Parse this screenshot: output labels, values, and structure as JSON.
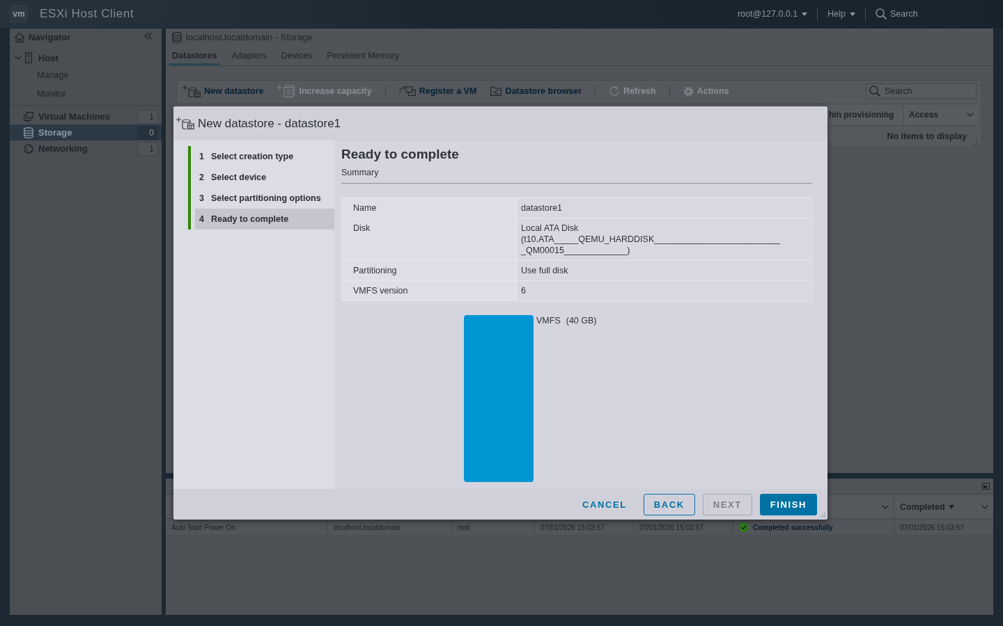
{
  "top_bar": {
    "logo": "vm",
    "title": "ESXi Host Client",
    "user_menu": "root@127.0.0.1",
    "help_menu": "Help",
    "search": {
      "placeholder": "Search"
    }
  },
  "navigator": {
    "title": "Navigator",
    "items": [
      {
        "label": "Host",
        "expanded": true,
        "selected": false,
        "children": [
          {
            "label": "Manage",
            "selected": false
          },
          {
            "label": "Monitor",
            "selected": false
          }
        ]
      },
      {
        "label": "Virtual Machines",
        "count": "1",
        "selected": false
      },
      {
        "label": "Storage",
        "count": "0",
        "selected": true
      },
      {
        "label": "Networking",
        "count": "1",
        "selected": false
      }
    ]
  },
  "storage_panel": {
    "title": "localhost.localdomain - Storage",
    "tabs": [
      {
        "label": "Datastores",
        "selected": true
      },
      {
        "label": "Adapters",
        "selected": false
      },
      {
        "label": "Devices",
        "selected": false
      },
      {
        "label": "Persistent Memory",
        "selected": false
      }
    ],
    "toolbar": [
      {
        "items": [
          {
            "label": "New datastore",
            "disabled": false
          },
          {
            "label": "Increase capacity",
            "disabled": true
          }
        ]
      },
      {
        "items": [
          {
            "label": "Register a VM",
            "disabled": false
          },
          {
            "label": "Datastore browser",
            "disabled": false
          }
        ]
      },
      {
        "items": [
          {
            "label": "Refresh",
            "disabled": true
          }
        ]
      },
      {
        "items": [
          {
            "label": "Actions",
            "disabled": true
          }
        ]
      }
    ],
    "search": {
      "placeholder": "Search"
    },
    "table": {
      "columns": [
        {
          "label": "hin provisioning",
          "menu": false
        },
        {
          "label": "Access",
          "menu": true
        }
      ],
      "empty_message": "No items to display"
    }
  },
  "recent_tasks": {
    "columns": [
      {},
      {},
      {},
      {},
      {},
      {
        "menu": true
      },
      {
        "label": "Completed",
        "sorted": true,
        "menu": true
      }
    ],
    "rows": [
      {
        "cells": [
          {
            "kind": "text",
            "text": "Auto Start Power On"
          },
          {
            "kind": "text",
            "text": "localhost.localdomain"
          },
          {
            "kind": "text",
            "text": "root"
          },
          {
            "kind": "text",
            "text": "07/01/2026 15:03:57"
          },
          {
            "kind": "text",
            "text": "07/01/2026 15:03:57"
          },
          {
            "kind": "success",
            "text": "Completed successfully"
          },
          {
            "kind": "text",
            "text": "07/01/2026 15:03:57"
          }
        ]
      }
    ]
  },
  "dialog": {
    "title": "New datastore - datastore1",
    "steps": [
      {
        "number": "1",
        "label": "Select creation type",
        "completed": true,
        "selected": false
      },
      {
        "number": "2",
        "label": "Select device",
        "completed": true,
        "selected": false
      },
      {
        "number": "3",
        "label": "Select partitioning options",
        "completed": true,
        "selected": false
      },
      {
        "number": "4",
        "label": "Ready to complete",
        "completed": true,
        "selected": true
      }
    ],
    "heading": "Ready to complete",
    "subheading": "Summary",
    "summary": [
      {
        "key": "Name",
        "value": "datastore1"
      },
      {
        "key": "Disk",
        "value": "Local ATA Disk (t10.ATA_____QEMU_HARDDISK___________________________QM00015_____________)"
      },
      {
        "key": "Partitioning",
        "value": "Use full disk"
      },
      {
        "key": "VMFS version",
        "value": "6"
      }
    ],
    "partitions": [
      {
        "name": "VMFS",
        "size": "(40 GB)"
      }
    ],
    "buttons": [
      {
        "label": "CANCEL",
        "kind": "flat",
        "disabled": false
      },
      {
        "label": "BACK",
        "kind": "outline",
        "disabled": false
      },
      {
        "label": "NEXT",
        "kind": "outline",
        "disabled": true
      },
      {
        "label": "FINISH",
        "kind": "primary",
        "disabled": false
      }
    ]
  }
}
